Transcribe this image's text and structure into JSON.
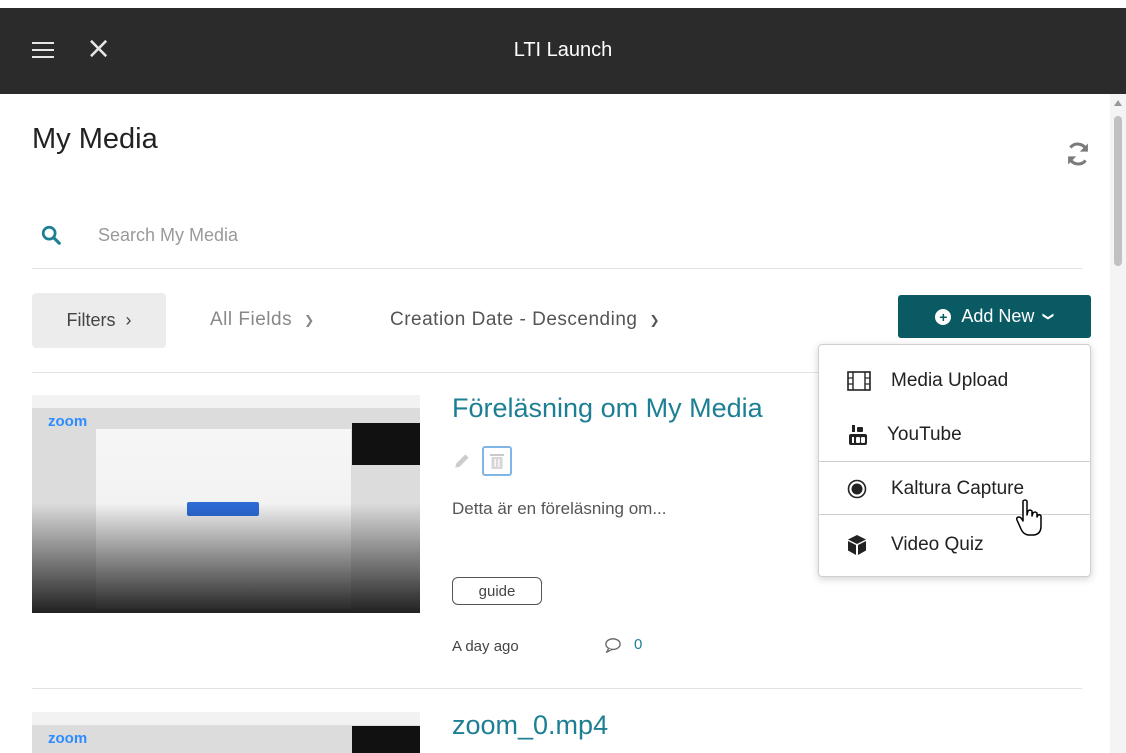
{
  "header": {
    "title": "LTI Launch"
  },
  "page": {
    "title": "My Media"
  },
  "search": {
    "placeholder": "Search My Media"
  },
  "toolbar": {
    "filters_label": "Filters",
    "field_filter": "All Fields",
    "sort": "Creation Date - Descending",
    "add_new": "Add New"
  },
  "add_menu": {
    "items": [
      {
        "label": "Media Upload",
        "icon": "film-icon"
      },
      {
        "label": "YouTube",
        "icon": "youtube-icon"
      },
      {
        "label": "Kaltura Capture",
        "icon": "record-icon"
      },
      {
        "label": "Video Quiz",
        "icon": "cube-icon"
      }
    ]
  },
  "entries": [
    {
      "title": "Föreläsning om My Media",
      "description": "Detta är en föreläsning om...",
      "tag": "guide",
      "date": "A day ago",
      "comments": "0",
      "thumb_logo": "zoom"
    },
    {
      "title": "zoom_0.mp4",
      "thumb_logo": "zoom"
    }
  ],
  "colors": {
    "topbar": "#2b2b2b",
    "accent": "#0a5a63",
    "link": "#1d7f93"
  }
}
